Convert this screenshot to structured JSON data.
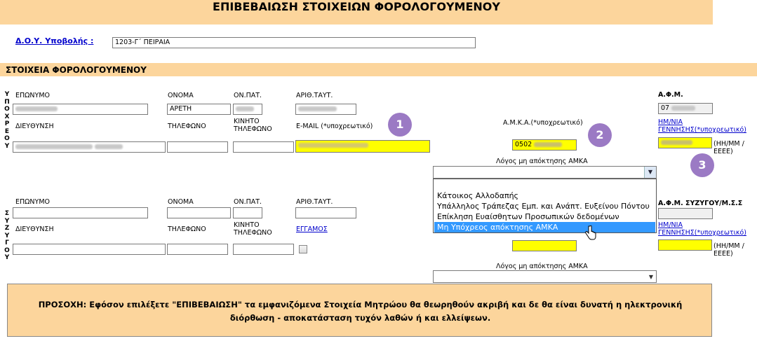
{
  "header": {
    "title": "ΕΠΙΒΕΒΑΙΩΣΗ ΣΤΟΙΧΕΙΩΝ ΦΟΡΟΛΟΓΟΥΜΕΝΟΥ"
  },
  "doy": {
    "label": "Δ.Ο.Υ. Υποβολής :",
    "value": "1203-Γ΄ ΠΕΙΡΑΙΑ"
  },
  "section": {
    "title": "ΣΤΟΙΧΕΙΑ ΦΟΡΟΛΟΓΟΥΜΕΝΟΥ"
  },
  "obligor": {
    "side_label": [
      "Υ",
      "Π",
      "Ο",
      "Χ",
      "Ρ",
      "Ε",
      "Ο",
      "Υ"
    ],
    "surname_label": "ΕΠΩΝΥΜΟ",
    "name_label": "ΟΝΟΜΑ",
    "name_value": "ΑΡΕΤΗ",
    "father_label": "ΟΝ.ΠΑΤ.",
    "id_label": "ΑΡΙΘ.ΤΑΥΤ.",
    "address_label": "ΔΙΕΥΘΥΝΣΗ",
    "phone_label": "ΤΗΛΕΦΩΝΟ",
    "mobile_label": "ΚΙΝΗΤΟ ΤΗΛΕΦΩΝΟ",
    "email_label": "E-MAIL (*υποχρεωτικό)",
    "amka_label": "Α.Μ.Κ.Α.(*υποχρεωτικό)",
    "amka_value": "0502",
    "no_amka_label": "Λόγος μη απόκτησης ΑΜΚΑ",
    "afm_label": "Α.Φ.Μ.",
    "afm_value": "07",
    "birth_link": "ΗΜ/ΝΙΑ ΓΕΝΝΗΣΗΣ(*υποχρεωτικό)",
    "birth_format": "(ΗΗ/ΜΜ /ΕΕΕΕ)"
  },
  "spouse": {
    "side_label": [
      "Σ",
      "Υ",
      "Ζ",
      "Υ",
      "Γ",
      "Ο",
      "Υ"
    ],
    "surname_label": "ΕΠΩΝΥΜΟ",
    "name_label": "ΟΝΟΜΑ",
    "father_label": "ΟΝ.ΠΑΤ.",
    "id_label": "ΑΡΙΘ.ΤΑΥΤ.",
    "address_label": "ΔΙΕΥΘΥΝΣΗ",
    "phone_label": "ΤΗΛΕΦΩΝΟ",
    "mobile_label": "ΚΙΝΗΤΟ ΤΗΛΕΦΩΝΟ",
    "married_link": "ΕΓΓΑΜΟΣ",
    "no_amka_label": "Λόγος μη απόκτησης ΑΜΚΑ",
    "afm_label": "Α.Φ.Μ. ΣΥΖΥΓΟΥ/Μ.Σ.Σ",
    "birth_link": "ΗΜ/ΝΙΑ ΓΕΝΝΗΣΗΣ(*υποχρεωτικό)",
    "birth_format": "(ΗΗ/ΜΜ /ΕΕΕΕ)"
  },
  "dropdown": {
    "options": [
      "",
      "Κάτοικος Αλλοδαπής",
      "Υπάλληλος Τράπεζας Εμπ. και Ανάπτ. Ευξείνου Πόντου",
      "Επίκληση Ευαίσθητων Προσωπικών δεδομένων",
      "Μη Υπόχρεος απόκτησης ΑΜΚΑ"
    ],
    "highlighted_index": 4
  },
  "badges": [
    "1",
    "2",
    "3"
  ],
  "warning": {
    "text": "ΠΡΟΣΟΧΗ: Εφόσον επιλέξετε \"ΕΠΙΒΕΒΑΙΩΣΗ\" τα εμφανιζόμενα Στοιχεία Μητρώου θα θεωρηθούν ακριβή και δε θα είναι δυνατή η ηλεκτρονική διόρθωση - αποκατάσταση τυχόν λαθών ή και ελλείψεων."
  },
  "colors": {
    "header_bg": "#fcd59c",
    "highlight": "#ffff00",
    "badge": "#9b7ac4",
    "link": "#0000cc",
    "selection": "#3399ff"
  },
  "icons": {
    "dropdown_arrow": "chevron-down-icon",
    "cursor": "hand-pointer-icon"
  }
}
